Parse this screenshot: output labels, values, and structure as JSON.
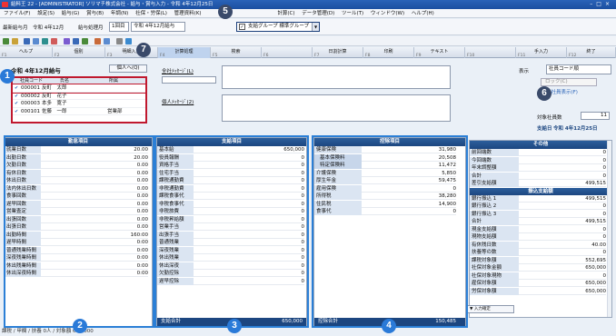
{
  "titlebar": {
    "title": "給料王 22 - [ADMINISTRATOR] ソリマチ株式会社 - 給与・賞与入力 - 令和 4年12月25日"
  },
  "menubar": {
    "items": [
      "ファイル(F)",
      "設定(S)",
      "給与(G)",
      "賞与(B)",
      "年調(N)",
      "社保・労保(L)",
      "管理資料(K)",
      "計算(C)",
      "データ管理(D)",
      "ツール(T)",
      "ウィンドウ(W)",
      "ヘルプ(H)"
    ]
  },
  "controls": {
    "saishin_label": "最新給与月",
    "saishin_value": "令和 4年12月",
    "kyuyo_label": "給与処理月",
    "kyuyo_mode": "1回目",
    "kyuyo_value": "令和 4年12月給与",
    "group_label": "支給グループ",
    "group_value": "標準グループ"
  },
  "fkeys": [
    {
      "n": "F1",
      "l": "ヘルプ"
    },
    {
      "n": "F2",
      "l": "個別"
    },
    {
      "n": "F3",
      "l": "明細入力"
    },
    {
      "n": "F4",
      "l": "計算処理"
    },
    {
      "n": "F5",
      "l": "検索"
    },
    {
      "n": "F6",
      "l": ""
    },
    {
      "n": "F7",
      "l": "日割計算"
    },
    {
      "n": "F8",
      "l": "印刷"
    },
    {
      "n": "F9",
      "l": "テキスト"
    },
    {
      "n": "F10",
      "l": ""
    },
    {
      "n": "F11",
      "l": "手入力"
    },
    {
      "n": "F12",
      "l": "終了"
    }
  ],
  "left": {
    "month_title": "令和 4年12月給与",
    "kojin_button": "個人へ(Q)",
    "headers": {
      "code": "社員コード",
      "name": "氏名",
      "dept": "所属"
    },
    "employees": [
      {
        "code": "000001",
        "name": "反町　太郎",
        "dept": ""
      },
      {
        "code": "000002",
        "name": "反町　花子",
        "dept": ""
      },
      {
        "code": "000003",
        "name": "本多　寛子",
        "dept": ""
      },
      {
        "code": "000101",
        "name": "佐藤　一郎",
        "dept": "営業部"
      }
    ]
  },
  "messages": {
    "zensha_label": "全社ﾒｯｾｰｼﾞ(L)",
    "kojin_label": "個人ﾒｯｾｰｼﾞ(2)"
  },
  "rightinfo": {
    "hyoji_label": "表示",
    "hyoji_value": "社員コード順",
    "lock_label": "ロック(C)",
    "zenin_label": "全社員表示(F)",
    "taisho_label": "対象社員数",
    "taisho_value": "11",
    "shikyubi_label": "支給日",
    "shikyubi_value": "令和 4年12月25日"
  },
  "kintai": {
    "title": "勤怠項目",
    "rows": [
      {
        "label": "就業日数",
        "value": "20.00"
      },
      {
        "label": "出勤日数",
        "value": "20.00"
      },
      {
        "label": "欠勤日数",
        "value": "0.00"
      },
      {
        "label": "有休日数",
        "value": "0.00"
      },
      {
        "label": "休出日数",
        "value": "0.00"
      },
      {
        "label": "法内休出日数",
        "value": "0.00"
      },
      {
        "label": "食事回数",
        "value": "0.00"
      },
      {
        "label": "遅早回数",
        "value": "0.00"
      },
      {
        "label": "営業査定",
        "value": "0.00"
      },
      {
        "label": "出張回数",
        "value": "0.00"
      },
      {
        "label": "出張日数",
        "value": "0.00"
      },
      {
        "label": "出勤時間",
        "value": "160:00"
      },
      {
        "label": "遅早時間",
        "value": "0:00"
      },
      {
        "label": "普通残業時間",
        "value": "0:00"
      },
      {
        "label": "深夜残業時間",
        "value": "0:00"
      },
      {
        "label": "休出残業時間",
        "value": "0:00"
      },
      {
        "label": "休出深夜時間",
        "value": "0:00"
      }
    ]
  },
  "shikyu": {
    "title": "支給項目",
    "rows": [
      {
        "label": "基本給",
        "value": "650,000"
      },
      {
        "label": "役員報酬",
        "value": "0"
      },
      {
        "label": "資格手当",
        "value": "0"
      },
      {
        "label": "住宅手当",
        "value": "0"
      },
      {
        "label": "課税通勤費",
        "value": "0"
      },
      {
        "label": "非税通勤費",
        "value": "0"
      },
      {
        "label": "課税食事代",
        "value": "0"
      },
      {
        "label": "非税食事代",
        "value": "0"
      },
      {
        "label": "非税旅費",
        "value": "0"
      },
      {
        "label": "非税昇給額",
        "value": "0"
      },
      {
        "label": "営業手当",
        "value": "0"
      },
      {
        "label": "出張手当",
        "value": "0"
      },
      {
        "label": "普通残業",
        "value": "0"
      },
      {
        "label": "深夜残業",
        "value": "0"
      },
      {
        "label": "休出残業",
        "value": "0"
      },
      {
        "label": "休出深夜",
        "value": "0"
      },
      {
        "label": "欠勤控除",
        "value": "0"
      },
      {
        "label": "遅早控除",
        "value": "0"
      }
    ],
    "total_label": "支給合計",
    "total_value": "650,000"
  },
  "kojo": {
    "title": "控除項目",
    "rows": [
      {
        "label": "健康保険",
        "value": "31,980",
        "sub": false
      },
      {
        "label": "基本保険料",
        "value": "20,508",
        "sub": true
      },
      {
        "label": "特定保険料",
        "value": "11,472",
        "sub": true
      },
      {
        "label": "介護保険",
        "value": "5,850",
        "sub": false
      },
      {
        "label": "厚生年金",
        "value": "59,475",
        "sub": false
      },
      {
        "label": "雇用保険",
        "value": "0",
        "sub": false
      },
      {
        "label": "所得税",
        "value": "38,280",
        "sub": false
      },
      {
        "label": "住民税",
        "value": "14,900",
        "sub": false
      },
      {
        "label": "食事代",
        "value": "0",
        "sub": false
      }
    ],
    "total_label": "控除合計",
    "total_value": "150,485"
  },
  "sonota": {
    "title": "その他",
    "rows": [
      {
        "label": "前回端数",
        "value": "0"
      },
      {
        "label": "今回端数",
        "value": "0"
      },
      {
        "label": "年末調整額",
        "value": "0"
      },
      {
        "label": "合計",
        "value": "0"
      },
      {
        "label": "差引支給額",
        "value": "499,515"
      }
    ],
    "furikomi_title": "振込支給額",
    "furikomi_rows": [
      {
        "label": "銀行振込 1",
        "value": "499,515"
      },
      {
        "label": "銀行振込 2",
        "value": "0"
      },
      {
        "label": "銀行振込 3",
        "value": "0"
      },
      {
        "label": "合計",
        "value": "499,515"
      },
      {
        "label": "現金支給額",
        "value": "0"
      },
      {
        "label": "現物支給額",
        "value": "0"
      },
      {
        "label": "有休残日数",
        "value": "40.00"
      },
      {
        "label": "扶養等の数",
        "value": "0"
      },
      {
        "label": "課税対象額",
        "value": "552,695"
      },
      {
        "label": "社保対象金額",
        "value": "650,000"
      },
      {
        "label": "社保対象現物",
        "value": "0"
      },
      {
        "label": "雇保対象額",
        "value": "650,000"
      },
      {
        "label": "労保対象額",
        "value": "650,000"
      }
    ]
  },
  "mini_popup": {
    "text": "▼ 入力確定"
  },
  "statusline": {
    "text": "課税 / 甲欄 / 扶養 0人 / 対象額 650,000"
  },
  "badges": [
    "1",
    "2",
    "3",
    "4",
    "5",
    "6",
    "7"
  ]
}
